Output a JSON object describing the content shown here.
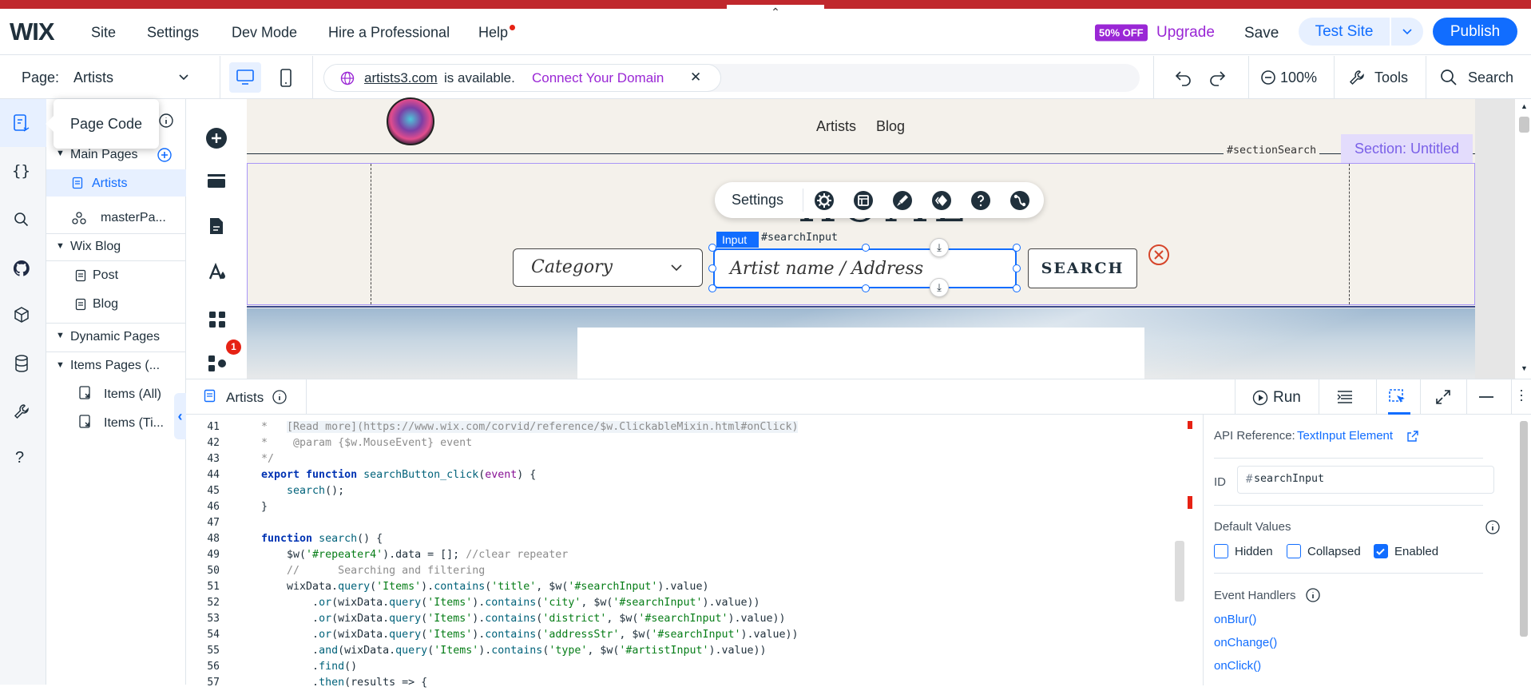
{
  "topbar": {
    "logo": "WIX",
    "menu": [
      "Site",
      "Settings",
      "Dev Mode",
      "Hire a Professional",
      "Help"
    ],
    "upgrade_badge": "50% OFF",
    "upgrade_label": "Upgrade",
    "save_label": "Save",
    "test_site_label": "Test Site",
    "publish_label": "Publish",
    "collapse_glyph": "⌃"
  },
  "secondbar": {
    "page_label": "Page:",
    "page_name": "Artists",
    "domain": "artists3.com",
    "domain_status": "is available.",
    "connect_label": "Connect Your Domain",
    "zoom": "100%",
    "tools_label": "Tools",
    "search_label": "Search"
  },
  "tooltip": {
    "text": "Page Code"
  },
  "pages_panel": {
    "main_header": "Main Pages",
    "main_items": [
      "Artists",
      "masterPa..."
    ],
    "blog_header": "Wix Blog",
    "blog_items": [
      "Post",
      "Blog"
    ],
    "dynamic_header": "Dynamic Pages",
    "items_header": "Items Pages (...",
    "items_items": [
      "Items (All)",
      "Items (Ti..."
    ]
  },
  "addrail": {
    "badge": "1"
  },
  "canvas": {
    "nav_links": [
      "Artists",
      "Blog"
    ],
    "section_anchor": "#sectionSearch",
    "section_label": "Section: Untitled",
    "heading": "HOME",
    "toolbar_settings": "Settings",
    "input_tag": "Input",
    "input_id": "#searchInput",
    "category_placeholder": "Category",
    "search_placeholder": "Artist name / Address",
    "search_button": "SEARCH"
  },
  "codepanel": {
    "tab_name": "Artists",
    "run_label": "Run",
    "line_numbers": [
      "41",
      "42",
      "43",
      "44",
      "45",
      "46",
      "47",
      "48",
      "49",
      "50",
      "51",
      "52",
      "53",
      "54",
      "55",
      "56",
      "57"
    ]
  },
  "properties": {
    "api_ref_label": "API Reference:",
    "api_ref_link": "TextInput Element",
    "id_label": "ID",
    "id_value": "searchInput",
    "default_values_label": "Default Values",
    "checks": [
      {
        "label": "Hidden",
        "checked": false
      },
      {
        "label": "Collapsed",
        "checked": false
      },
      {
        "label": "Enabled",
        "checked": true
      }
    ],
    "event_handlers_label": "Event Handlers",
    "handlers": [
      "onBlur()",
      "onChange()",
      "onClick()"
    ]
  },
  "colors": {
    "accent": "#116dff",
    "upgrade": "#9a27d5",
    "section": "#a996f7",
    "top_strip": "#c0282d"
  }
}
